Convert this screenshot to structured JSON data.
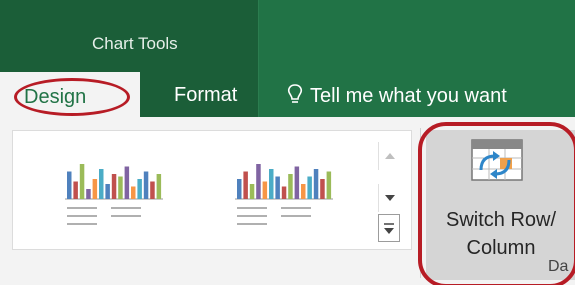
{
  "contextual_group": {
    "label": "Chart Tools"
  },
  "tabs": [
    {
      "label": "Design"
    },
    {
      "label": "Format"
    }
  ],
  "tell_me": {
    "label": "Tell me what you want"
  },
  "chart_styles": {
    "thumbnails": [
      {
        "bars": [
          0.55,
          0.35,
          0.7,
          0.2,
          0.4,
          0.6,
          0.3,
          0.5,
          0.45,
          0.65,
          0.25,
          0.4,
          0.55,
          0.35,
          0.5
        ]
      },
      {
        "bars": [
          0.4,
          0.55,
          0.3,
          0.7,
          0.35,
          0.6,
          0.45,
          0.25,
          0.5,
          0.65,
          0.3,
          0.45,
          0.6,
          0.4,
          0.55
        ]
      }
    ]
  },
  "switch_button": {
    "line1": "Switch Row/",
    "line2": "Column"
  },
  "partial_label": "Da",
  "colors": {
    "ribbon": "#217346",
    "group": "#1b5e38",
    "highlight": "#b71c25"
  }
}
